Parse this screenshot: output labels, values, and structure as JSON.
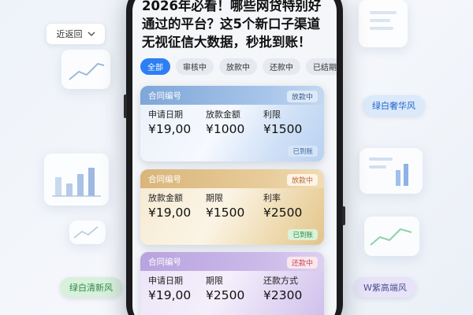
{
  "select": {
    "label": "近返回",
    "icon": "chevron-down-icon"
  },
  "side_labels": {
    "left_green": "绿白清新风",
    "right_blue": "绿白奢华风",
    "right_purple": "W紫高端风"
  },
  "headline": "2026年必看！哪些网贷特别好通过的平台？这5个新口子渠道无视征信大数据，秒批到账！",
  "tabs": [
    {
      "label": "全部",
      "active": true
    },
    {
      "label": "审核中",
      "active": false
    },
    {
      "label": "放款中",
      "active": false
    },
    {
      "label": "还款中",
      "active": false
    },
    {
      "label": "已结期",
      "active": false
    }
  ],
  "cards": [
    {
      "theme": "blue",
      "header": "合同编号",
      "status": "放款中",
      "fields": [
        {
          "label": "申请日期",
          "value": "¥19,00"
        },
        {
          "label": "放款金额",
          "value": "¥1000"
        },
        {
          "label": "利限",
          "value": "¥1500"
        }
      ],
      "badge": "已到账"
    },
    {
      "theme": "gold",
      "header": "合同编号",
      "status": "放款中",
      "fields": [
        {
          "label": "放款金额",
          "value": "¥19,00"
        },
        {
          "label": "期限",
          "value": "¥1500"
        },
        {
          "label": "利率",
          "value": "¥2500"
        }
      ],
      "badge": "已到账"
    },
    {
      "theme": "purple",
      "header": "合同编号",
      "status": "还款中",
      "fields": [
        {
          "label": "申请日期",
          "value": "¥19,00"
        },
        {
          "label": "期限",
          "value": "¥2500"
        },
        {
          "label": "还款方式",
          "value": "¥2300"
        }
      ],
      "badge": ""
    }
  ],
  "colors": {
    "accent": "#2d7ff3",
    "green_pill_bg": "#d8f0dc",
    "green_pill_text": "#2e8a45",
    "blue_pill_bg": "#dbe9fb",
    "blue_pill_text": "#1f66c9",
    "purple_pill_bg": "#e8e3f8",
    "purple_pill_text": "#4a4f8f"
  }
}
